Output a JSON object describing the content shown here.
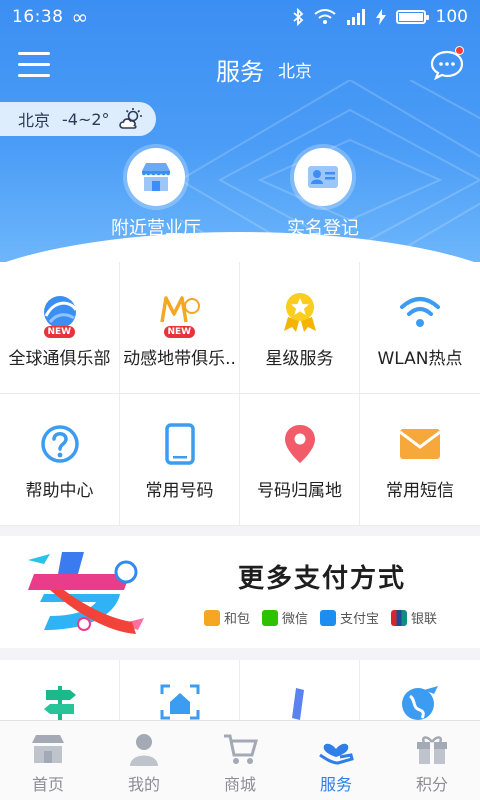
{
  "statusbar": {
    "time": "16:38",
    "battery": "100",
    "battery_level": 0.95
  },
  "navbar": {
    "title": "服务",
    "city": "北京"
  },
  "weather": {
    "city": "北京",
    "temp": "-4~2°"
  },
  "quick_actions": [
    {
      "label": "附近营业厅",
      "icon": "store-icon"
    },
    {
      "label": "实名登记",
      "icon": "id-card-icon"
    }
  ],
  "services": [
    {
      "label": "全球通俱乐部",
      "icon": "globe-club-icon",
      "badge": "NEW"
    },
    {
      "label": "动感地带俱乐..",
      "icon": "mzone-club-icon",
      "badge": "NEW"
    },
    {
      "label": "星级服务",
      "icon": "star-medal-icon"
    },
    {
      "label": "WLAN热点",
      "icon": "wifi-icon"
    },
    {
      "label": "帮助中心",
      "icon": "help-icon"
    },
    {
      "label": "常用号码",
      "icon": "phone-icon"
    },
    {
      "label": "号码归属地",
      "icon": "location-pin-icon"
    },
    {
      "label": "常用短信",
      "icon": "mail-icon"
    }
  ],
  "payment": {
    "title": "更多支付方式",
    "methods": [
      {
        "label": "和包",
        "color": "#f5a623"
      },
      {
        "label": "微信",
        "color": "#2dc100"
      },
      {
        "label": "支付宝",
        "color": "#1d8ef0"
      },
      {
        "label": "银联",
        "color": "#d7262b"
      }
    ]
  },
  "tabs": [
    {
      "label": "首页",
      "icon": "home-store-icon"
    },
    {
      "label": "我的",
      "icon": "user-icon"
    },
    {
      "label": "商城",
      "icon": "cart-icon"
    },
    {
      "label": "服务",
      "icon": "service-heart-icon",
      "active": true
    },
    {
      "label": "积分",
      "icon": "gift-icon"
    }
  ],
  "colors": {
    "primary": "#3c8ff2",
    "active_tab": "#2e7fe8",
    "inactive_tab": "#8e8e93"
  }
}
